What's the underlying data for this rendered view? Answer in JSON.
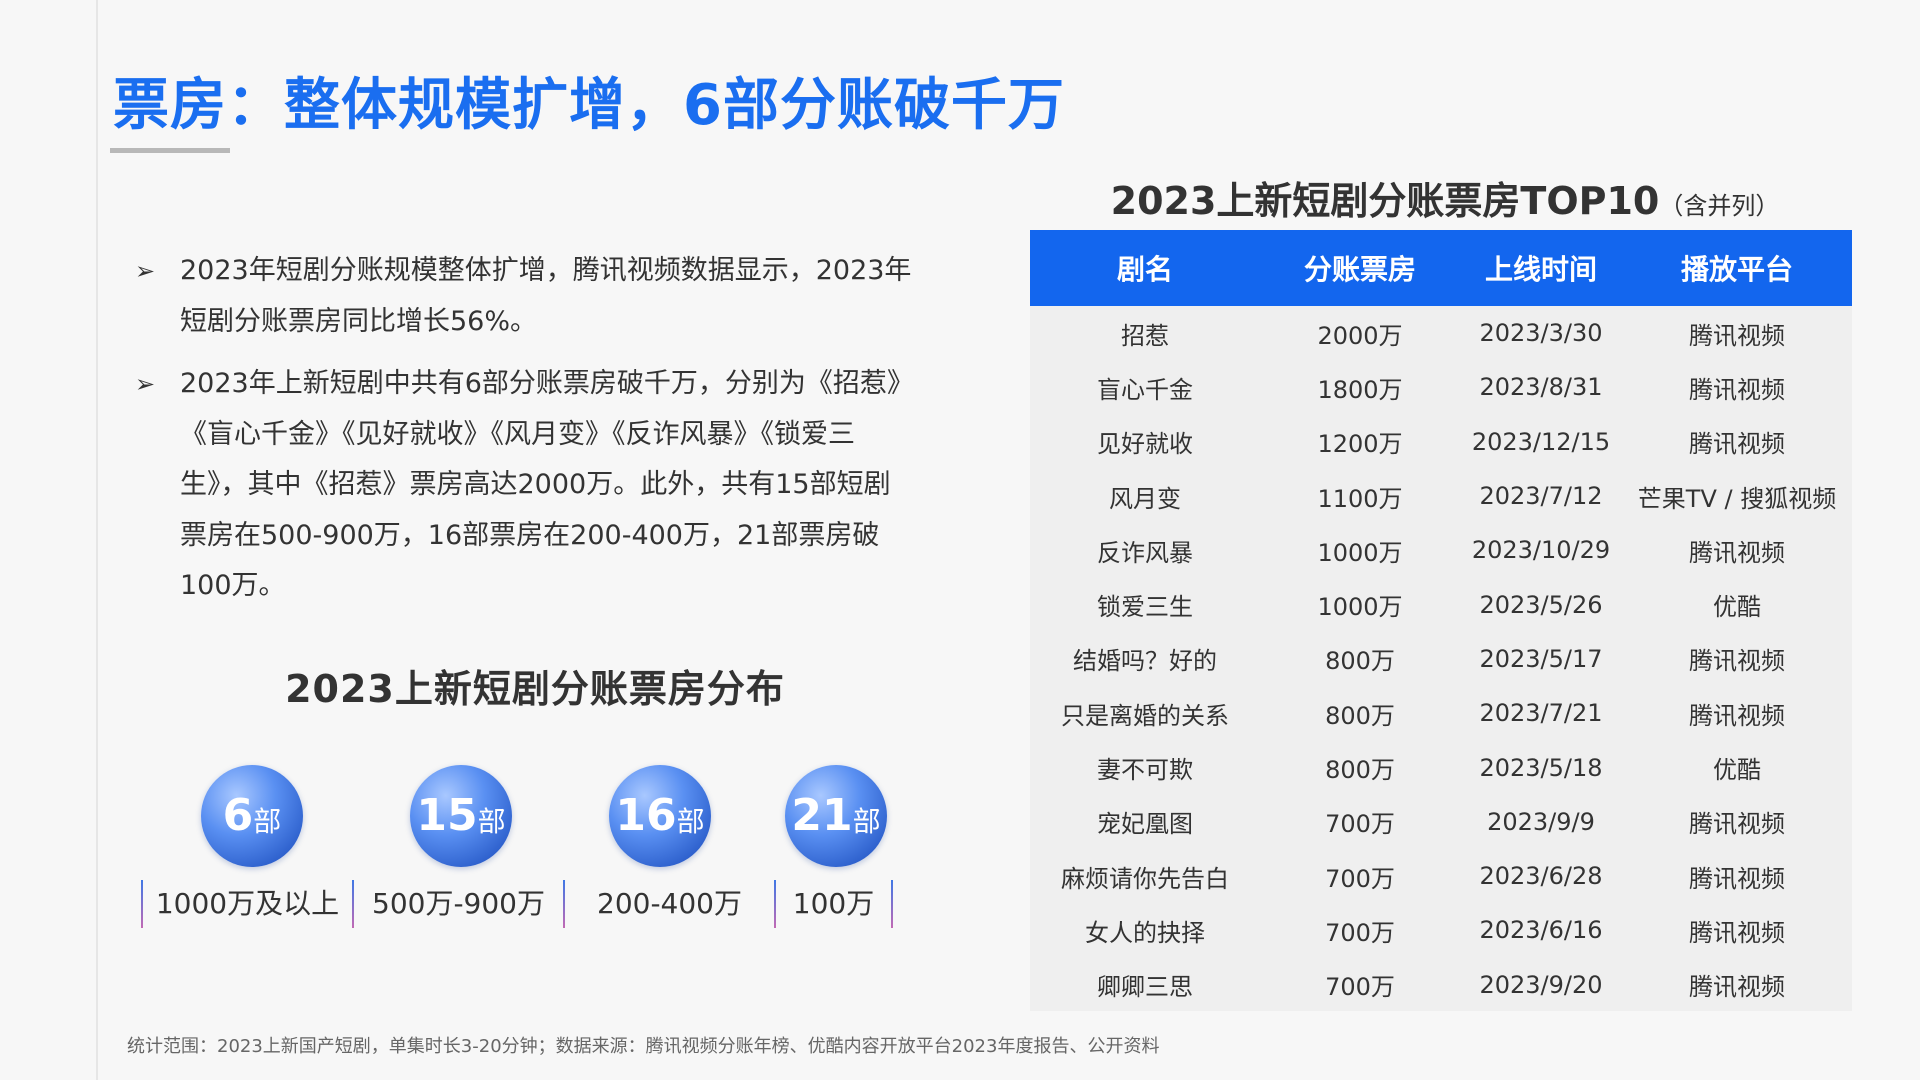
{
  "title": "票房：整体规模扩增，6部分账破千万",
  "bullets": [
    "2023年短剧分账规模整体扩增，腾讯视频数据显示，2023年短剧分账票房同比增长56%。",
    "2023年上新短剧中共有6部分账票房破千万，分别为《招惹》《盲心千金》《见好就收》《风月变》《反诈风暴》《锁爱三生》，其中《招惹》票房高达2000万。此外，共有15部短剧票房在500-900万，16部票房在200-400万，21部票房破100万。"
  ],
  "bullet_marker": "➢",
  "distribution": {
    "title": "2023上新短剧分账票房分布",
    "unit": "部",
    "items": [
      {
        "count": "6",
        "label": "1000万及以上"
      },
      {
        "count": "15",
        "label": "500万-900万"
      },
      {
        "count": "16",
        "label": "200-400万"
      },
      {
        "count": "21",
        "label": "100万"
      }
    ]
  },
  "table": {
    "title": "2023上新短剧分账票房TOP10",
    "subtitle": "（含并列）",
    "headers": [
      "剧名",
      "分账票房",
      "上线时间",
      "播放平台"
    ],
    "rows": [
      [
        "招惹",
        "2000万",
        "2023/3/30",
        "腾讯视频"
      ],
      [
        "盲心千金",
        "1800万",
        "2023/8/31",
        "腾讯视频"
      ],
      [
        "见好就收",
        "1200万",
        "2023/12/15",
        "腾讯视频"
      ],
      [
        "风月变",
        "1100万",
        "2023/7/12",
        "芒果TV / 搜狐视频"
      ],
      [
        "反诈风暴",
        "1000万",
        "2023/10/29",
        "腾讯视频"
      ],
      [
        "锁爱三生",
        "1000万",
        "2023/5/26",
        "优酷"
      ],
      [
        "结婚吗？好的",
        "800万",
        "2023/5/17",
        "腾讯视频"
      ],
      [
        "只是离婚的关系",
        "800万",
        "2023/7/21",
        "腾讯视频"
      ],
      [
        "妻不可欺",
        "800万",
        "2023/5/18",
        "优酷"
      ],
      [
        "宠妃凰图",
        "700万",
        "2023/9/9",
        "腾讯视频"
      ],
      [
        "麻烦请你先告白",
        "700万",
        "2023/6/28",
        "腾讯视频"
      ],
      [
        "女人的抉择",
        "700万",
        "2023/6/16",
        "腾讯视频"
      ],
      [
        "卿卿三思",
        "700万",
        "2023/9/20",
        "腾讯视频"
      ]
    ]
  },
  "footnote": "统计范围：2023上新国产短剧，单集时长3-20分钟；数据来源：腾讯视频分账年榜、优酷内容开放平台2023年度报告、公开资料",
  "colors": {
    "title_blue": "#1a6ef0",
    "table_header_blue": "#1366ee"
  }
}
